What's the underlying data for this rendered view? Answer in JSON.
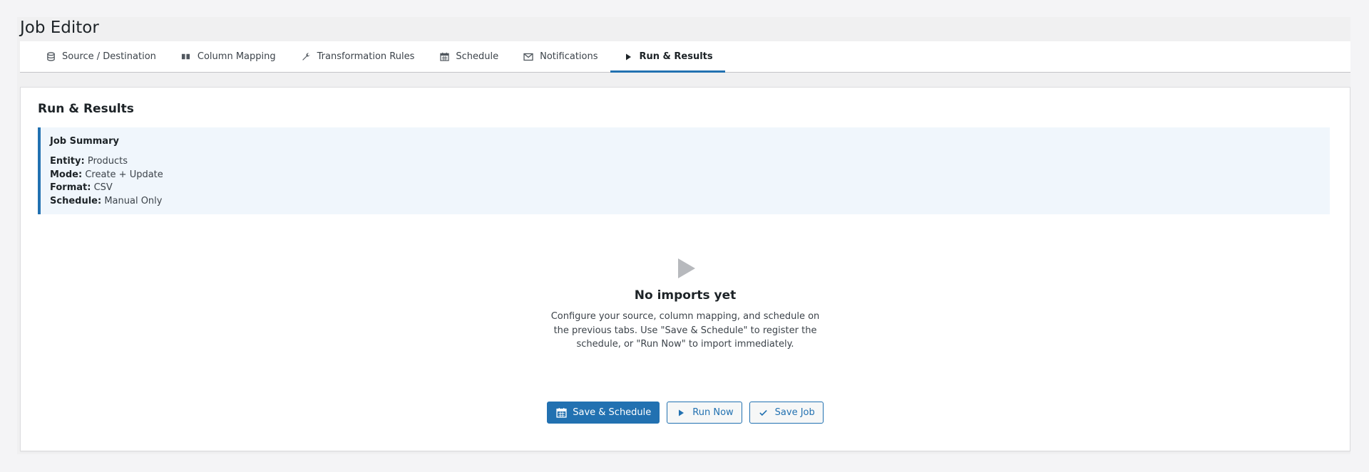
{
  "page": {
    "title": "Job Editor"
  },
  "tabs": [
    {
      "label": "Source / Destination",
      "icon": "database-icon",
      "active": false
    },
    {
      "label": "Column Mapping",
      "icon": "columns-icon",
      "active": false
    },
    {
      "label": "Transformation Rules",
      "icon": "wrench-icon",
      "active": false
    },
    {
      "label": "Schedule",
      "icon": "calendar-icon",
      "active": false
    },
    {
      "label": "Notifications",
      "icon": "envelope-icon",
      "active": false
    },
    {
      "label": "Run & Results",
      "icon": "play-icon",
      "active": true
    }
  ],
  "panel": {
    "title": "Run & Results",
    "summary": {
      "heading": "Job Summary",
      "rows": [
        {
          "label": "Entity:",
          "value": "Products"
        },
        {
          "label": "Mode:",
          "value": "Create + Update"
        },
        {
          "label": "Format:",
          "value": "CSV"
        },
        {
          "label": "Schedule:",
          "value": "Manual Only"
        }
      ]
    },
    "empty_state": {
      "icon": "play-icon",
      "title": "No imports yet",
      "message": "Configure your source, column mapping, and schedule on the previous tabs. Use \"Save & Schedule\" to register the schedule, or \"Run Now\" to import immediately."
    },
    "actions": {
      "save_schedule": "Save & Schedule",
      "run_now": "Run Now",
      "save_job": "Save Job"
    }
  },
  "colors": {
    "accent": "#2271b1",
    "summary_bg": "#f0f6fc",
    "page_bg": "#f0f0f1"
  }
}
